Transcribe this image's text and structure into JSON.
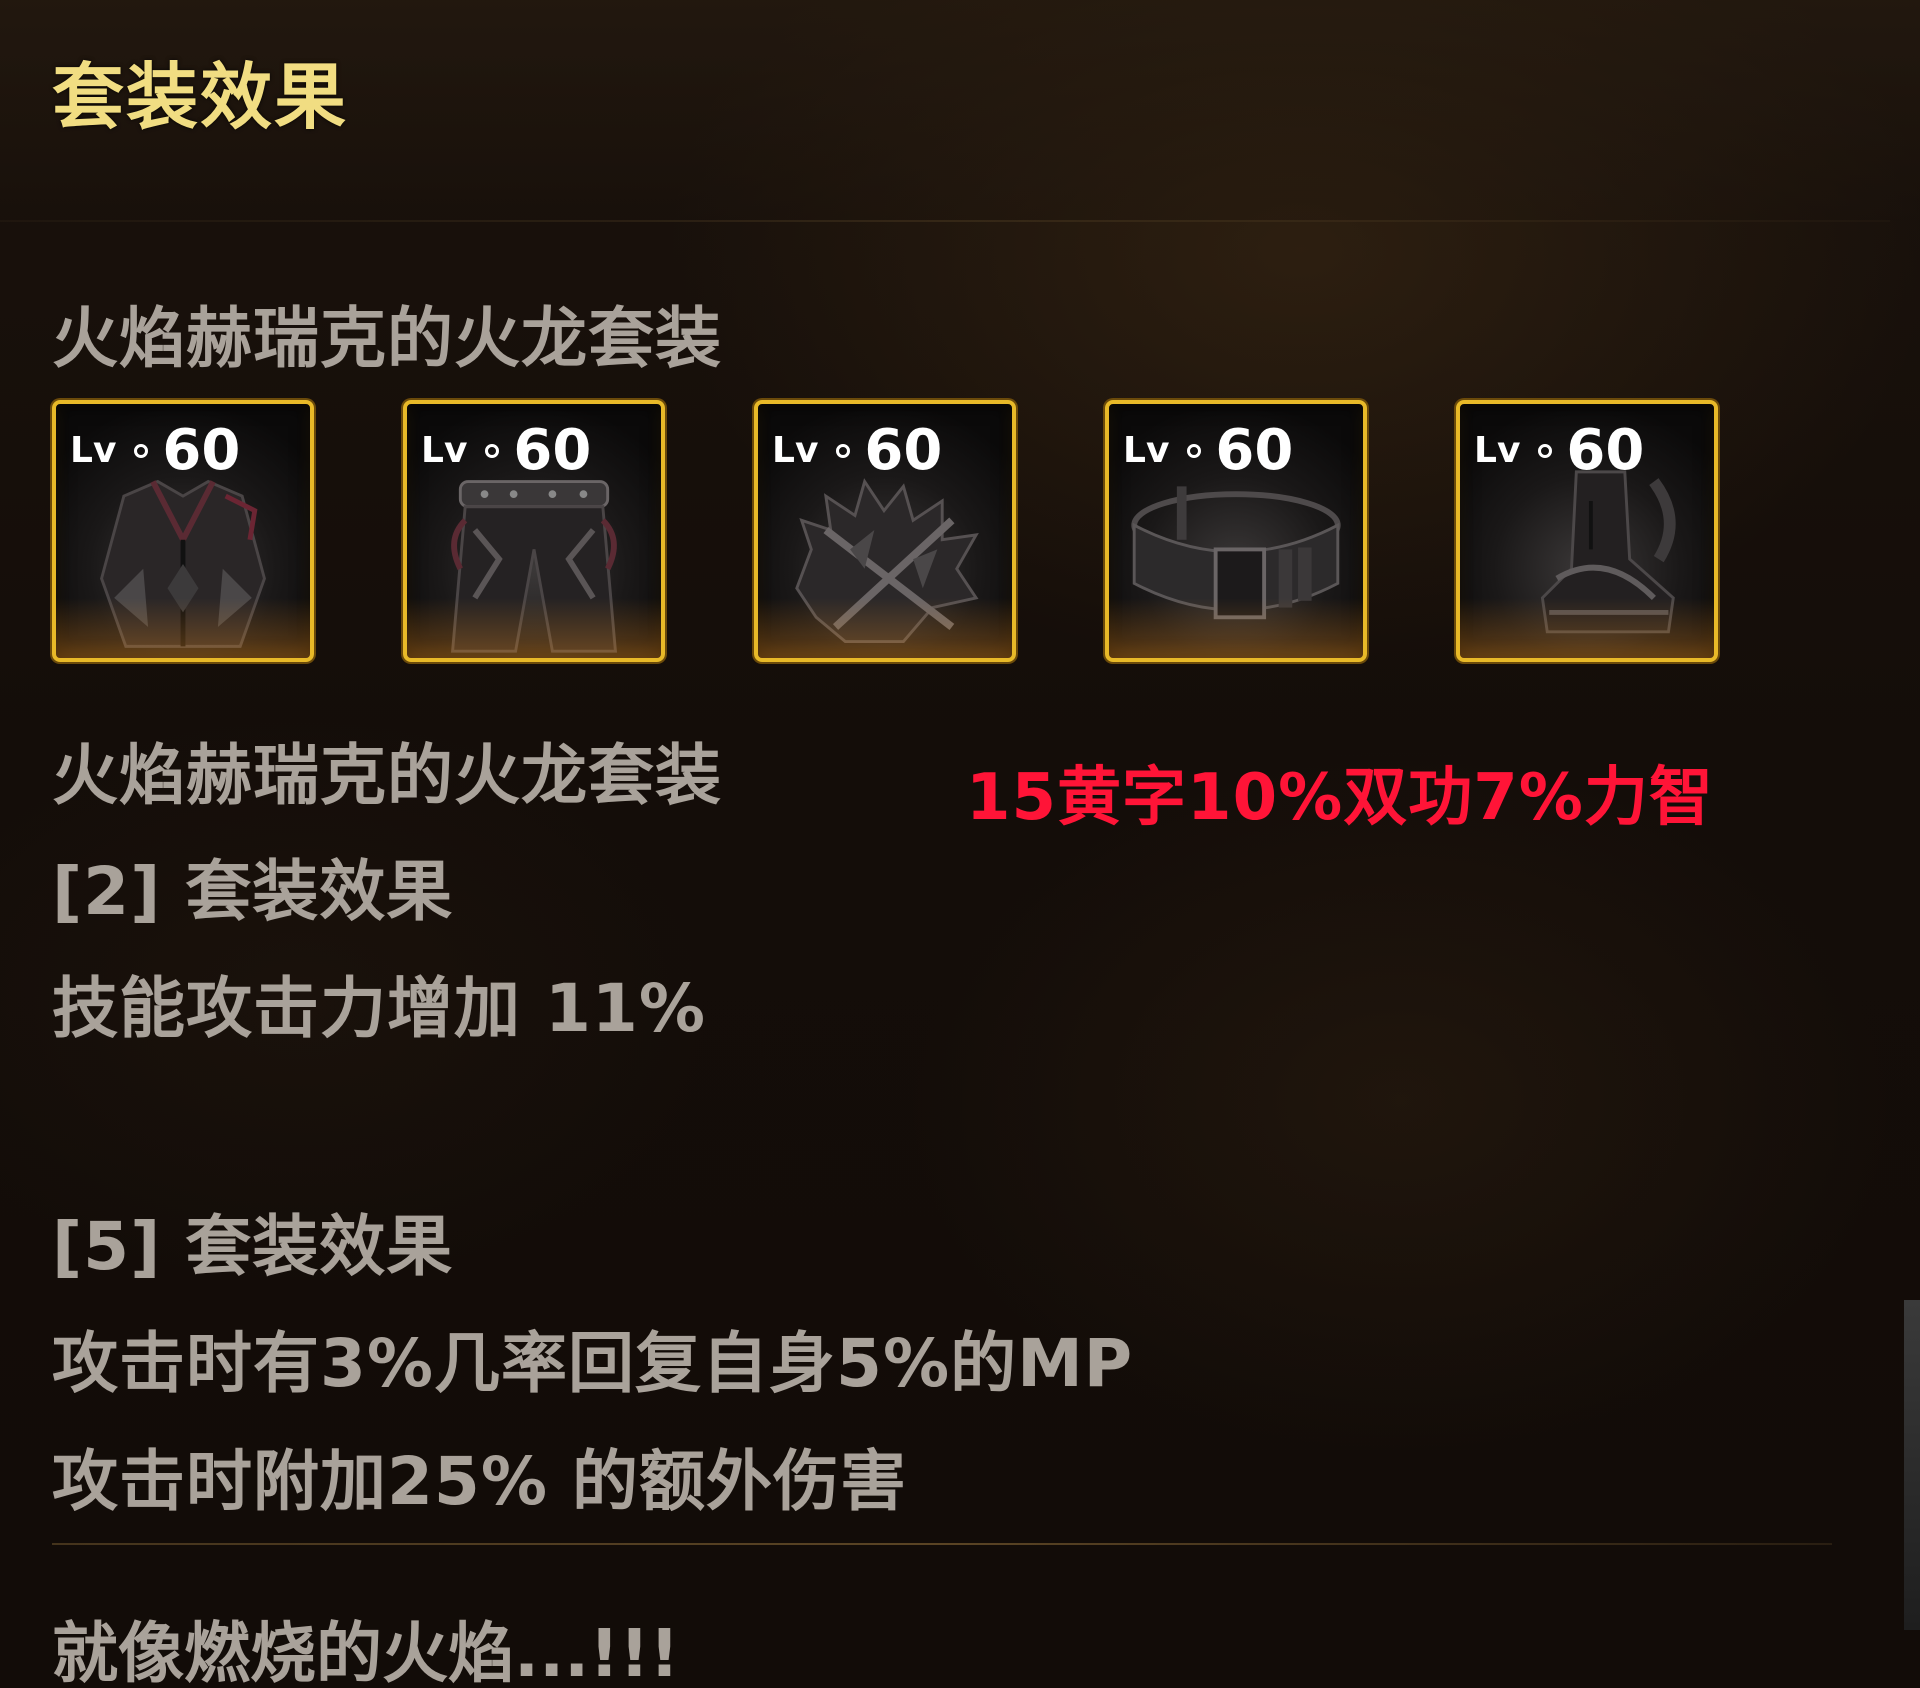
{
  "panel": {
    "title": "套装效果",
    "set_name": "火焰赫瑞克的火龙套装"
  },
  "items": [
    {
      "level_prefix": "Lv",
      "level": "60",
      "icon": "jacket-armor-icon"
    },
    {
      "level_prefix": "Lv",
      "level": "60",
      "icon": "pants-armor-icon"
    },
    {
      "level_prefix": "Lv",
      "level": "60",
      "icon": "shoulder-armor-icon"
    },
    {
      "level_prefix": "Lv",
      "level": "60",
      "icon": "belt-armor-icon"
    },
    {
      "level_prefix": "Lv",
      "level": "60",
      "icon": "boots-armor-icon"
    }
  ],
  "set_details": {
    "set_name": "火焰赫瑞克的火龙套装",
    "bonus_2": {
      "title": "[2] 套装效果",
      "effects": [
        "技能攻击力增加 11%"
      ]
    },
    "bonus_5": {
      "title": "[5] 套装效果",
      "effects": [
        "攻击时有3%几率回复自身5%的MP",
        "攻击时附加25% 的额外伤害"
      ]
    },
    "flavor_text": "就像燃烧的火焰...!!!"
  },
  "annotation": {
    "text": "15黄字10%双功7%力智",
    "color": "#ff1437"
  },
  "colors": {
    "title": "#f1dd82",
    "body_text": "#a9a29a",
    "slot_border": "#e8b928"
  }
}
